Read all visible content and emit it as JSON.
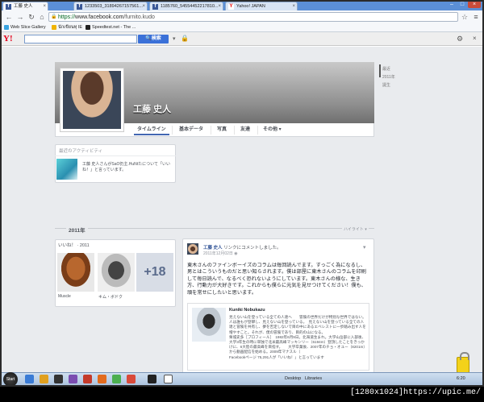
{
  "browser": {
    "tabs": [
      {
        "label": "工藤 史人",
        "icon": "facebook-icon"
      },
      {
        "label": "1233503_31894267157561...",
        "icon": "facebook-icon"
      },
      {
        "label": "1185760_54554452217810...",
        "icon": "facebook-icon"
      },
      {
        "label": "Yahoo! JAPAN",
        "icon": "yahoo-icon"
      }
    ],
    "url_scheme": "https://",
    "url_host": "www.facebook.com",
    "url_path": "/furnito.kudo",
    "bookmarks": [
      "Web Slice Gallery",
      "นักเขียนทุ IE",
      "Speedtest.net - The ..."
    ]
  },
  "yahoo_toolbar": {
    "logo": "Y!",
    "search_button": "検索"
  },
  "profile": {
    "name": "工藤 史人",
    "nav": [
      "タイムライン",
      "基本データ",
      "写真",
      "友達",
      "その他 ▾"
    ]
  },
  "scrubber": [
    "最近",
    "2011年",
    "誕生"
  ],
  "activity": {
    "title": "最近のアクティビティ",
    "text": "工藤 史人さんがSaO仍主.HuNtたについて「いいね！」と言っています。"
  },
  "timeline": {
    "year": "2011年",
    "year_option": "ハイライト ▾"
  },
  "likes": {
    "title": "いいね！ · 2011",
    "items": [
      {
        "caption": "Muscle"
      },
      {
        "caption": "キム・ボドク"
      }
    ],
    "more": "+18"
  },
  "post": {
    "author": "工藤 史人",
    "action": "リンクにコメントしました。",
    "date": "2011年12月02日",
    "body": "東木さんのファインボーイズのコラムは毎回読んでます。すっごく為になるし、男とはこういうものだと思い知らされます。僕は部屋に東木さんのコラムを印刷して毎日読んで、なるべく恐れないようにしています。東木さんの様な、生き方、行動力が大好きです。これからも僕らに元気を見せつけてください！僕も、頑を常せにしたいと思います。",
    "quote_title": "Kuniki Nobukazu",
    "quote_body": "見えない山を登っている全ての人達へ　　冒険の世界だけが特別な世界ではない。人は誰もが登攀し、見えない山を登っている。　見えない山を登っている全ての人達と冒険を共有し、夢を否定しないで目の中にあるエベレストに一歩踏み出す人を増やすこと。それが、僕の冒険であり、目的の山になる。　　　　　　　　　　　栗城史多［プロフィール］　1982年6月9日。北海道生まれ。大学山岳部に入部後、大学3年生の時に単独で北米最高峰マッキンリー（6194m）登頂したことをきっかけに、6大陸の最高峰を目指す。　　大学卒業後、2007年のチョ・オユー（8201m）から動画配信を始める。2009年マナスル（",
    "quote_footer": "Facebookページ 75,291人が「いいね！」と言っています"
  },
  "taskbar": {
    "start": "Start",
    "items": [
      "Desktop",
      "Libraries"
    ],
    "clock": "6:20"
  },
  "watermark": "[1280x1024]https://upic.me/"
}
